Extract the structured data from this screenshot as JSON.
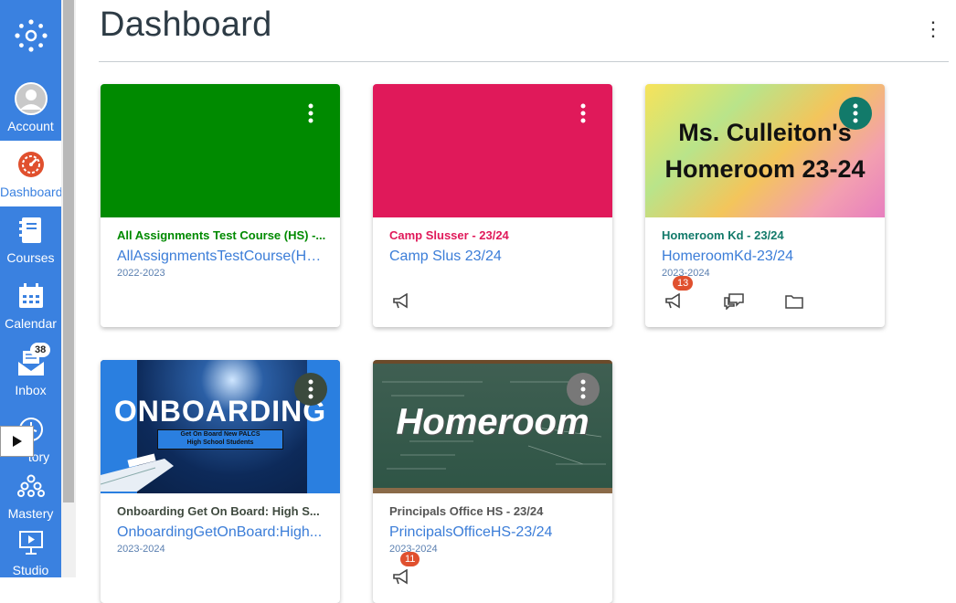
{
  "nav": {
    "items": [
      {
        "label": "Account"
      },
      {
        "label": "Dashboard"
      },
      {
        "label": "Courses"
      },
      {
        "label": "Calendar"
      },
      {
        "label": "Inbox",
        "badge": "38"
      },
      {
        "label": "History"
      },
      {
        "label": "Mastery"
      },
      {
        "label": "Studio"
      }
    ],
    "history_visible": "tory"
  },
  "page": {
    "title": "Dashboard",
    "menu_icon": "⋮"
  },
  "cards": [
    {
      "color": "#008a00",
      "title": "All Assignments Test Course (HS) -...",
      "code": "AllAssignmentsTestCourse(HS)...",
      "term": "2022-2023",
      "actions": [
        "announcements"
      ]
    },
    {
      "color": "#e0195a",
      "title": "Camp Slusser - 23/24",
      "code": "Camp Slus 23/24",
      "term": "",
      "actions": [
        "announcements"
      ]
    },
    {
      "color": "#127a6a",
      "title": "Homeroom Kd - 23/24",
      "code": "HomeroomKd-23/24",
      "term": "2023-2024",
      "hero_text": [
        "Ms. Culleiton's",
        "Homeroom 23-24"
      ],
      "actions": [
        "announcements",
        "discussions",
        "files"
      ],
      "announce_badge": "13"
    },
    {
      "color": "#1b2b4a",
      "title": "Onboarding Get On Board: High S...",
      "code": "OnboardingGetOnBoard:High...",
      "term": "2023-2024",
      "hero_text": [
        "ONBOARDING",
        "Get On Board New PALCS",
        "High School Students"
      ]
    },
    {
      "color": "#555555",
      "title": "Principals Office HS - 23/24",
      "code": "PrincipalsOfficeHS-23/24",
      "term": "2023-2024",
      "hero_text": [
        "Homeroom"
      ],
      "announce_badge": "11"
    }
  ]
}
